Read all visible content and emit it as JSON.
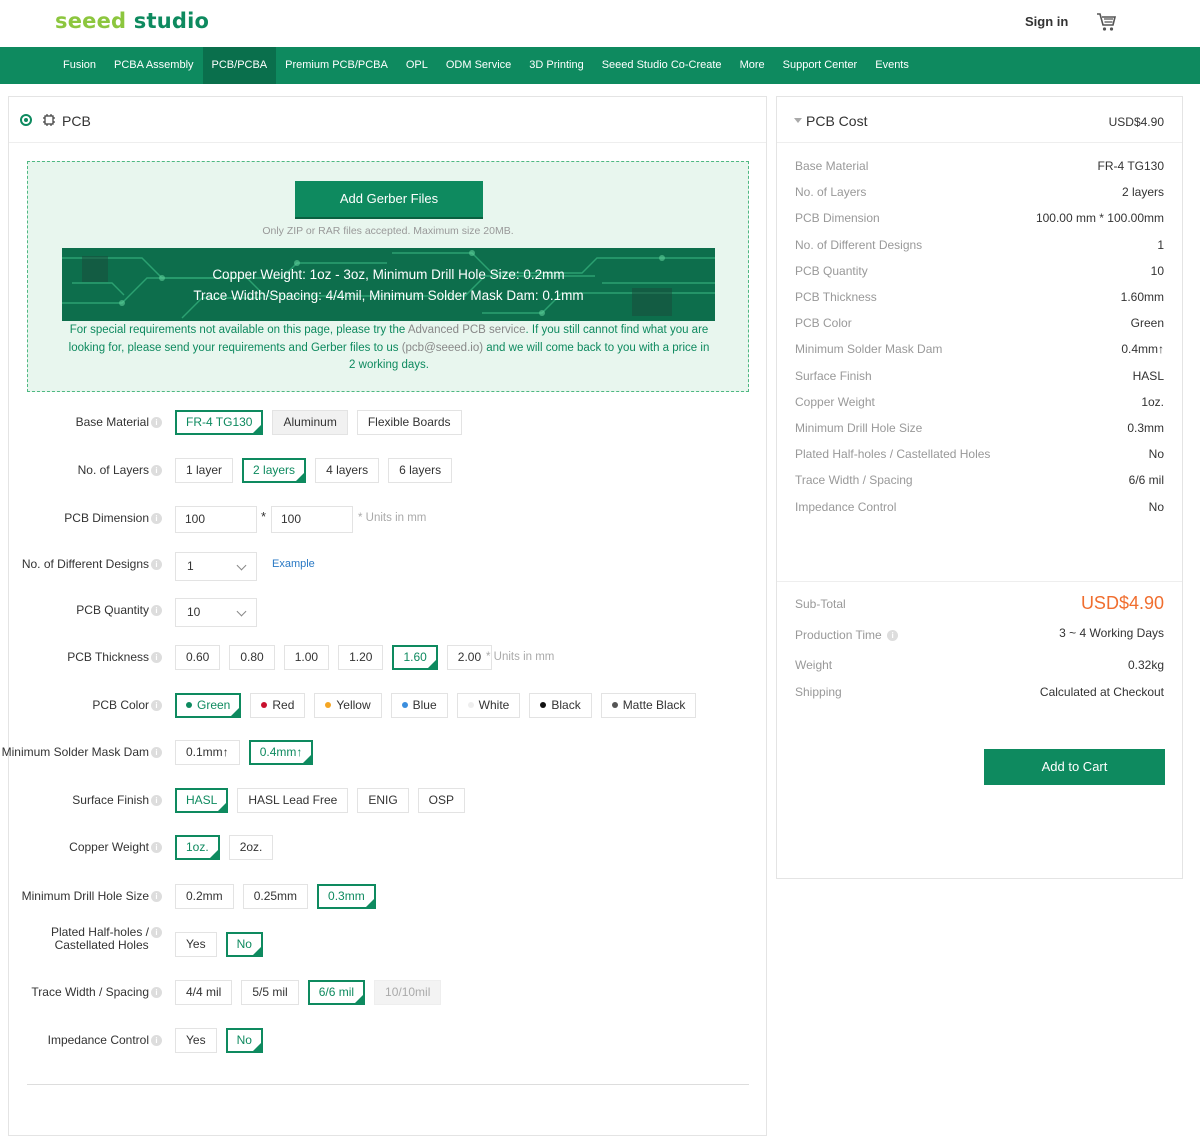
{
  "brand": {
    "part1": "seeed",
    "part2": " studio"
  },
  "header": {
    "signin": "Sign in"
  },
  "nav": [
    "Fusion",
    "PCBA Assembly",
    "PCB/PCBA",
    "Premium PCB/PCBA",
    "OPL",
    "ODM Service",
    "3D Printing",
    "Seeed Studio Co-Create",
    "More",
    "Support Center",
    "Events"
  ],
  "nav_active": "PCB/PCBA",
  "section_title": "PCB",
  "upload": {
    "button": "Add Gerber Files",
    "note": "Only ZIP or RAR files accepted. Maximum size 20MB.",
    "banner_line1": "Copper Weight: 1oz - 3oz, Minimum Drill Hole Size: 0.2mm",
    "banner_line2": "Trace Width/Spacing: 4/4mil, Minimum Solder Mask Dam: 0.1mm",
    "special_a": "For special requirements not available on this page, please try the ",
    "special_link": "Advanced PCB service",
    "special_b": ". If you still cannot find what you are looking for, please send your requirements and Gerber files to us ",
    "special_email": "(pcb@seeed.io)",
    "special_c": " and we will come back to you with a price in 2 working days."
  },
  "form": {
    "base_material": {
      "label": "Base Material",
      "options": [
        "FR-4 TG130",
        "Aluminum",
        "Flexible Boards"
      ],
      "selected": "FR-4 TG130"
    },
    "layers": {
      "label": "No. of Layers",
      "options": [
        "1 layer",
        "2 layers",
        "4 layers",
        "6 layers"
      ],
      "selected": "2 layers"
    },
    "dimension": {
      "label": "PCB Dimension",
      "x": "100",
      "sep": "*",
      "y": "100",
      "unit": "* Units in mm"
    },
    "designs": {
      "label": "No. of Different Designs",
      "value": "1",
      "link": "Example"
    },
    "quantity": {
      "label": "PCB Quantity",
      "value": "10"
    },
    "thickness": {
      "label": "PCB Thickness",
      "options": [
        "0.60",
        "0.80",
        "1.00",
        "1.20",
        "1.60",
        "2.00"
      ],
      "selected": "1.60",
      "unit": "* Units in mm"
    },
    "color": {
      "label": "PCB Color",
      "options": [
        "Green",
        "Red",
        "Yellow",
        "Blue",
        "White",
        "Black",
        "Matte Black"
      ],
      "dots": [
        "#0e8a5f",
        "#c8102e",
        "#f5a623",
        "#3b8ede",
        "#eeeeee",
        "#111111",
        "#555555"
      ],
      "selected": "Green"
    },
    "mask_dam": {
      "label": "Minimum Solder Mask Dam",
      "options": [
        "0.1mm↑",
        "0.4mm↑"
      ],
      "selected": "0.4mm↑"
    },
    "finish": {
      "label": "Surface Finish",
      "options": [
        "HASL",
        "HASL Lead Free",
        "ENIG",
        "OSP"
      ],
      "selected": "HASL"
    },
    "copper": {
      "label": "Copper Weight",
      "options": [
        "1oz.",
        "2oz."
      ],
      "selected": "1oz."
    },
    "drill": {
      "label": "Minimum Drill Hole Size",
      "options": [
        "0.2mm",
        "0.25mm",
        "0.3mm"
      ],
      "selected": "0.3mm"
    },
    "halfholes": {
      "label1": "Plated Half-holes /",
      "label2": "Castellated Holes",
      "options": [
        "Yes",
        "No"
      ],
      "selected": "No"
    },
    "trace": {
      "label": "Trace Width / Spacing",
      "options": [
        "4/4 mil",
        "5/5 mil",
        "6/6 mil",
        "10/10mil"
      ],
      "selected": "6/6 mil",
      "disabled": "10/10mil"
    },
    "impedance": {
      "label": "Impedance Control",
      "options": [
        "Yes",
        "No"
      ],
      "selected": "No"
    }
  },
  "cost": {
    "title": "PCB Cost",
    "price": "USD$4.90",
    "specs": [
      {
        "k": "Base Material",
        "v": "FR-4 TG130"
      },
      {
        "k": "No. of Layers",
        "v": "2 layers"
      },
      {
        "k": "PCB Dimension",
        "v": "100.00 mm * 100.00mm"
      },
      {
        "k": "No. of Different Designs",
        "v": "1"
      },
      {
        "k": "PCB Quantity",
        "v": "10"
      },
      {
        "k": "PCB Thickness",
        "v": "1.60mm"
      },
      {
        "k": "PCB Color",
        "v": "Green"
      },
      {
        "k": "Minimum Solder Mask Dam",
        "v": "0.4mm↑"
      },
      {
        "k": "Surface Finish",
        "v": "HASL"
      },
      {
        "k": "Copper Weight",
        "v": "1oz."
      },
      {
        "k": "Minimum Drill Hole Size",
        "v": "0.3mm"
      },
      {
        "k": "Plated Half-holes / Castellated Holes",
        "v": "No"
      },
      {
        "k": "Trace Width / Spacing",
        "v": "6/6 mil"
      },
      {
        "k": "Impedance Control",
        "v": "No"
      }
    ],
    "subtotal_label": "Sub-Total",
    "subtotal": "USD$4.90",
    "production_label": "Production Time",
    "production": "3 ~ 4 Working Days",
    "weight_label": "Weight",
    "weight": "0.32kg",
    "shipping_label": "Shipping",
    "shipping": "Calculated at Checkout",
    "add_to_cart": "Add to Cart"
  },
  "colors": {
    "brand_green": "#0e8a5f",
    "accent_orange": "#f06e2f"
  }
}
